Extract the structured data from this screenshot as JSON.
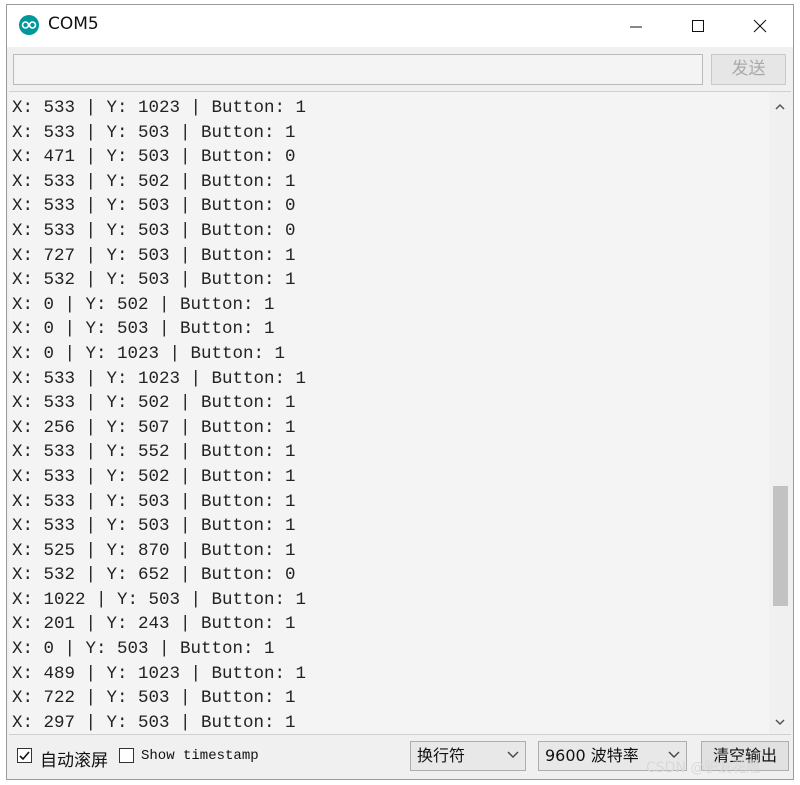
{
  "window": {
    "title": "COM5",
    "icon": "arduino-logo-icon"
  },
  "send": {
    "input_value": "",
    "button_label": "发送"
  },
  "output": {
    "lines": [
      "X: 533 | Y: 1023 | Button: 1",
      "X: 533 | Y: 503 | Button: 1",
      "X: 471 | Y: 503 | Button: 0",
      "X: 533 | Y: 502 | Button: 1",
      "X: 533 | Y: 503 | Button: 0",
      "X: 533 | Y: 503 | Button: 0",
      "X: 727 | Y: 503 | Button: 1",
      "X: 532 | Y: 503 | Button: 1",
      "X: 0 | Y: 502 | Button: 1",
      "X: 0 | Y: 503 | Button: 1",
      "X: 0 | Y: 1023 | Button: 1",
      "X: 533 | Y: 1023 | Button: 1",
      "X: 533 | Y: 502 | Button: 1",
      "X: 256 | Y: 507 | Button: 1",
      "X: 533 | Y: 552 | Button: 1",
      "X: 533 | Y: 502 | Button: 1",
      "X: 533 | Y: 503 | Button: 1",
      "X: 533 | Y: 503 | Button: 1",
      "X: 525 | Y: 870 | Button: 1",
      "X: 532 | Y: 652 | Button: 0",
      "X: 1022 | Y: 503 | Button: 1",
      "X: 201 | Y: 243 | Button: 1",
      "X: 0 | Y: 503 | Button: 1",
      "X: 489 | Y: 1023 | Button: 1",
      "X: 722 | Y: 503 | Button: 1",
      "X: 297 | Y: 503 | Button: 1"
    ],
    "scroll_position": 0.78
  },
  "bottom": {
    "autoscroll_label": "自动滚屏",
    "autoscroll_checked": true,
    "timestamp_label": "Show timestamp",
    "timestamp_checked": false,
    "line_ending": "换行符",
    "baud_rate": "9600 波特率",
    "clear_label": "清空输出"
  },
  "watermark": "CSDN @驴友花雕"
}
